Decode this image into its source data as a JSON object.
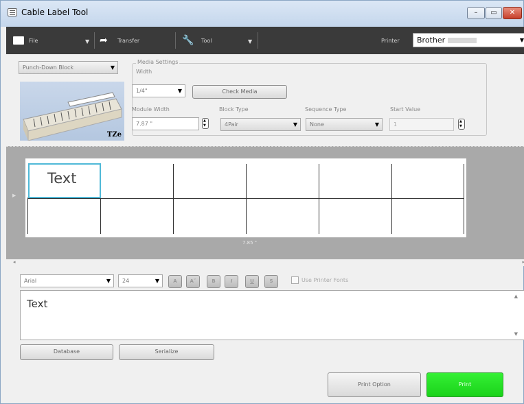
{
  "window": {
    "title": "Cable Label Tool"
  },
  "toolbar": {
    "file_label": "File",
    "transfer_label": "Transfer",
    "tool_label": "Tool",
    "printer_label": "Printer",
    "printer_value": "Brother"
  },
  "settings": {
    "application_select": "Punch-Down Block",
    "media_group_title": "Media Settings",
    "width_label": "Width",
    "width_value": "1/4\"",
    "check_media_label": "Check Media",
    "module_width_label": "Module Width",
    "module_width_value": "7.87 \"",
    "block_type_label": "Block Type",
    "block_type_value": "4Pair",
    "sequence_type_label": "Sequence Type",
    "sequence_type_value": "None",
    "start_value_label": "Start Value",
    "start_value_value": "1",
    "tape_brand": "TZe"
  },
  "canvas": {
    "cell_text": "Text",
    "length_label": "7.85 \""
  },
  "format": {
    "font_value": "Arial",
    "size_value": "24",
    "use_printer_fonts_label": "Use Printer Fonts"
  },
  "editor": {
    "text": "Text"
  },
  "footer": {
    "database_label": "Database",
    "serialize_label": "Serialize",
    "print_option_label": "Print Option",
    "print_label": "Print"
  },
  "colors": {
    "print_button": "#22dd22",
    "selection_border": "#4fb9d8",
    "toolbar_bg": "#3a3a3a"
  }
}
